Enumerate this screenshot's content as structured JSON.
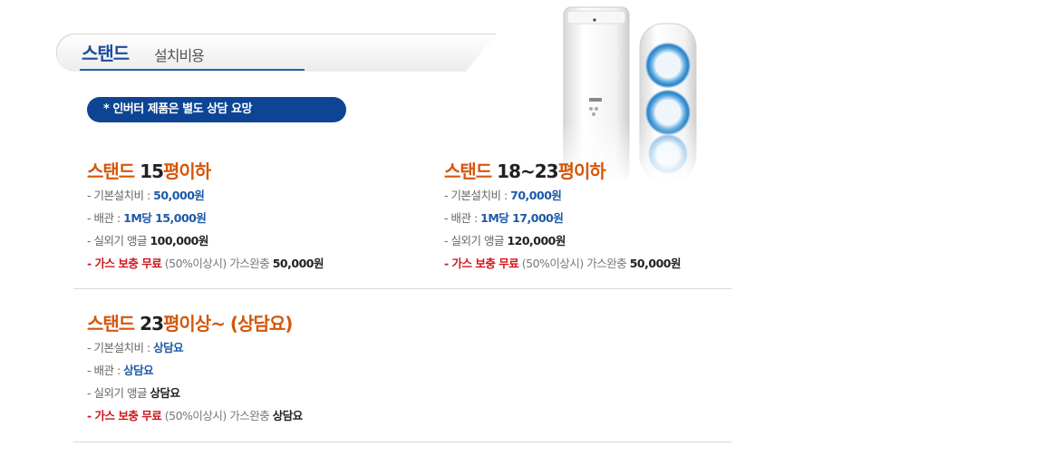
{
  "header": {
    "title": "스탠드",
    "subtitle": "설치비용"
  },
  "notice": "* 인버터 제품은 별도 상담 요망",
  "sections": [
    {
      "title_prefix": "스탠드 ",
      "title_num": "15",
      "title_suffix": "평이하",
      "base_label": "- 기본설치비 : ",
      "base_value": "50,000원",
      "pipe_label": "- 배관 : ",
      "pipe_value": "1M당 15,000원",
      "angle_label": "- 실외기 앵글 ",
      "angle_value": "100,000원",
      "gas_dash": "- ",
      "gas_red": "가스 보충 무료",
      "gas_note": " (50%이상시)  가스완충 ",
      "gas_value": "50,000원"
    },
    {
      "title_prefix": "스탠드 ",
      "title_num": "18~23",
      "title_suffix": "평이하",
      "base_label": "- 기본설치비 : ",
      "base_value": "70,000원",
      "pipe_label": "- 배관 : ",
      "pipe_value": "1M당 17,000원",
      "angle_label": "- 실외기 앵글 ",
      "angle_value": "120,000원",
      "gas_dash": "- ",
      "gas_red": "가스 보충 무료",
      "gas_note": " (50%이상시)  가스완충 ",
      "gas_value": "50,000원"
    },
    {
      "title_prefix": "스탠드 ",
      "title_num": "23",
      "title_suffix": "평이상~ (상담요)",
      "base_label": "- 기본설치비 : ",
      "base_value": "상담요",
      "pipe_label": "- 배관 : ",
      "pipe_value": "상담요",
      "angle_label": "- 실외기 앵글 ",
      "angle_value": "상담요",
      "gas_dash": "- ",
      "gas_red": "가스 보충 무료",
      "gas_note": " (50%이상시)  가스완충 ",
      "gas_value": "상담요"
    }
  ],
  "product_image": {
    "icon": "stand-air-conditioner-image"
  }
}
